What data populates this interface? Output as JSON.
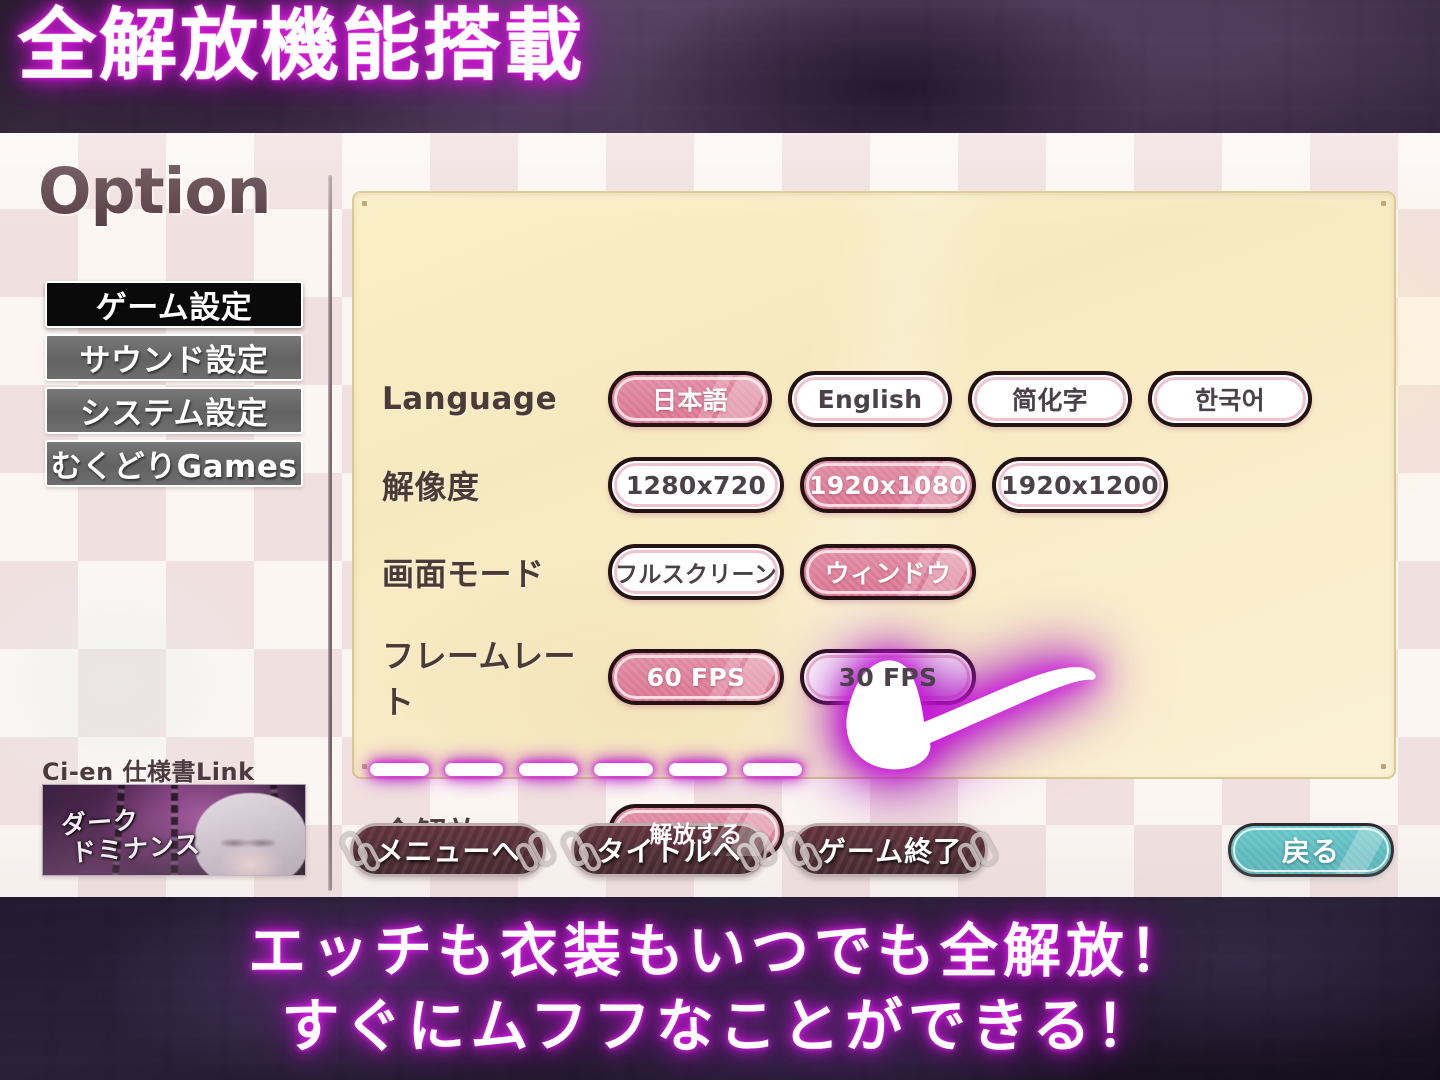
{
  "promo": {
    "headline": "全解放機能搭載",
    "caption_line1": "エッチも衣装もいつでも全解放！",
    "caption_line2": "すぐにムフフなことができる！"
  },
  "option_screen": {
    "title": "Option",
    "sidebar": {
      "items": [
        {
          "label": "ゲーム設定",
          "active": true
        },
        {
          "label": "サウンド設定",
          "active": false
        },
        {
          "label": "システム設定",
          "active": false
        },
        {
          "label": "むくどりGames",
          "active": false
        }
      ]
    },
    "cien": {
      "label": "Ci-en 仕様書Link",
      "thumb_title_line1": "ダーク",
      "thumb_title_line2": "ドミナンス"
    },
    "rows": [
      {
        "label": "Language",
        "options": [
          {
            "label": "日本語",
            "selected": true
          },
          {
            "label": "English",
            "selected": false
          },
          {
            "label": "简化字",
            "selected": false
          },
          {
            "label": "한국어",
            "selected": false
          }
        ]
      },
      {
        "label": "解像度",
        "options": [
          {
            "label": "1280x720",
            "selected": false
          },
          {
            "label": "1920x1080",
            "selected": true
          },
          {
            "label": "1920x1200",
            "selected": false
          }
        ]
      },
      {
        "label": "画面モード",
        "options": [
          {
            "label": "フルスクリーン",
            "selected": false
          },
          {
            "label": "ウィンドウ",
            "selected": true
          }
        ]
      },
      {
        "label": "フレームレート",
        "options": [
          {
            "label": "60 FPS",
            "selected": true
          },
          {
            "label": "30 FPS",
            "selected": false
          }
        ]
      },
      {
        "label": "全解放",
        "options": [
          {
            "label": "解放する",
            "selected": true
          }
        ]
      }
    ],
    "actions": [
      {
        "label": "メニューへ"
      },
      {
        "label": "タイトルへ"
      },
      {
        "label": "ゲーム終了"
      }
    ],
    "back_button": "戻る"
  },
  "annotation": {
    "arrow": "arrow-left",
    "dash_count": 6
  },
  "colors": {
    "selected_pill": "#dc7d98",
    "panel_bg": "#f9edc6",
    "back_button": "#4fb8bd",
    "glow": "#d618e6",
    "sidebar_active": "#0a0a0a",
    "sidebar_inactive": "#6b6b6b"
  }
}
